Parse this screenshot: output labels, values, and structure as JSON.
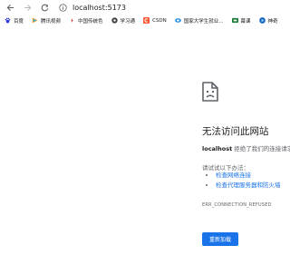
{
  "browser": {
    "url": "localhost:5173"
  },
  "bookmarks": [
    {
      "label": "百度",
      "icon": "baidu-paw-icon",
      "color": "#2932e1"
    },
    {
      "label": "腾讯视频",
      "icon": "tencent-video-icon",
      "color": "#ff8a00"
    },
    {
      "label": "中国传统色",
      "icon": "traditional-color-icon",
      "color": "#e53935"
    },
    {
      "label": "学习通",
      "icon": "xuexitong-icon",
      "color": "#3c4043"
    },
    {
      "label": "CSDN",
      "icon": "csdn-icon",
      "color": "#fc5531"
    },
    {
      "label": "国家大学生就业...",
      "icon": "job-service-icon",
      "color": "#1e88e5"
    },
    {
      "label": "幕课",
      "icon": "mooc-icon",
      "color": "#1b7f3b"
    },
    {
      "label": "神奇",
      "icon": "shenqi-icon",
      "color": "#1565c0"
    }
  ],
  "error": {
    "title": "无法访问此网站",
    "host": "localhost",
    "description": " 拒绝了我们的连接请求。",
    "try_label": "请试试以下办法：",
    "suggestions": [
      "检查网络连接",
      "检查代理服务器和防火墙"
    ],
    "code": "ERR_CONNECTION_REFUSED",
    "reload_label": "重新加载"
  },
  "colors": {
    "accent": "#1a73e8",
    "text": "#202124",
    "muted": "#5f6368"
  }
}
